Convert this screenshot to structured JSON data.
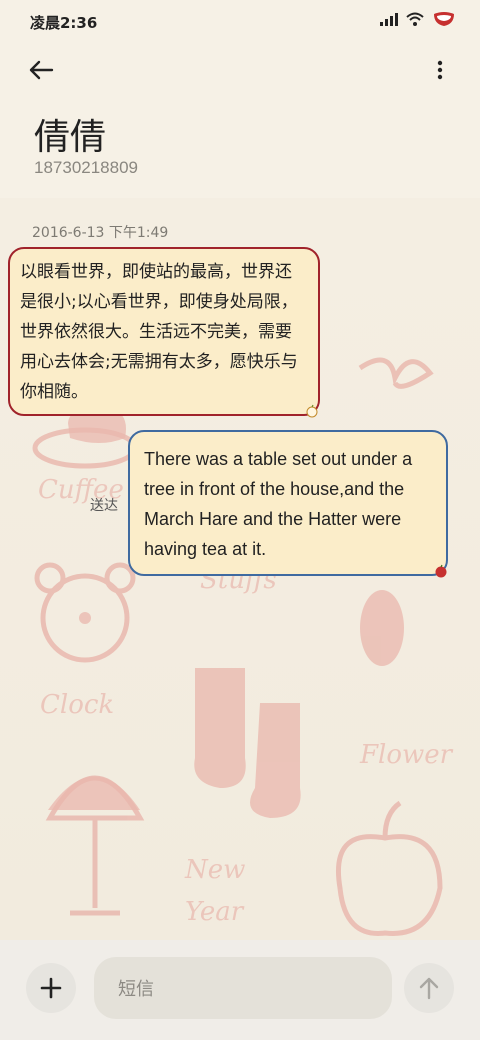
{
  "status": {
    "time": "凌晨2:36"
  },
  "contact": {
    "name": "倩倩",
    "number": "18730218809"
  },
  "messages": {
    "timestamp": "2016-6-13 下午1:49",
    "incoming": "以眼看世界，即使站的最高，世界还是很小;以心看世界，即使身处局限，世界依然很大。生活远不完美，需要用心去体会;无需拥有太多，愿快乐与你相随。",
    "outgoing": "There was a table set out under a tree in front of the house,and the March Hare and the Hatter were having tea at it.",
    "delivered_label": "送达"
  },
  "input": {
    "placeholder": "短信"
  },
  "icons": {
    "back": "arrow-left-icon",
    "more": "more-vertical-icon",
    "add": "plus-icon",
    "send": "arrow-up-icon",
    "signal": "signal-icon",
    "wifi": "wifi-icon",
    "battery": "battery-icon"
  },
  "colors": {
    "incoming_border": "#a0232b",
    "outgoing_border": "#3f6aa0",
    "bubble_fill": "#fbedc9",
    "background": "#f6f1e6"
  }
}
